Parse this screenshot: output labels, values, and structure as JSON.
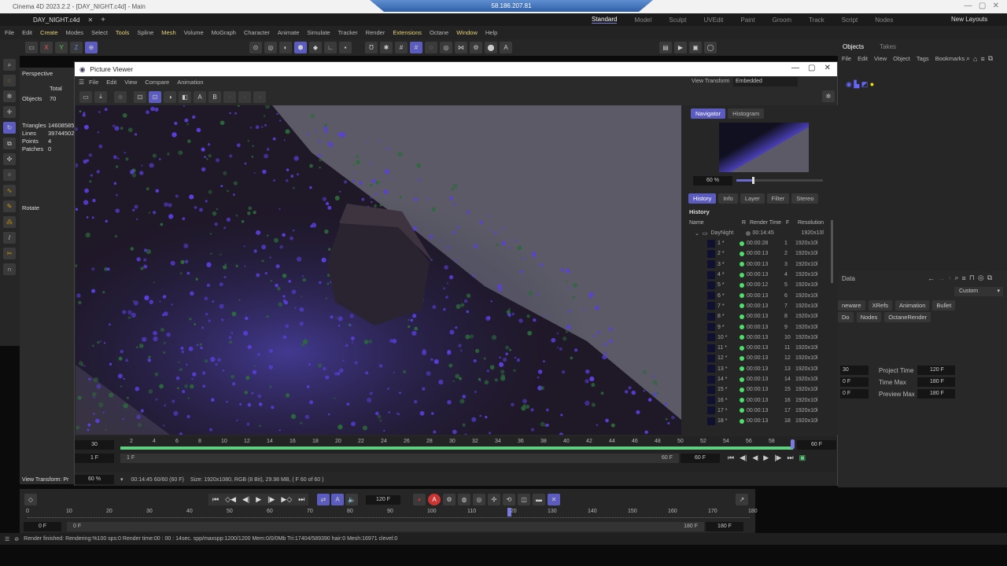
{
  "app": {
    "title": "Cinema 4D 2023.2.2 - [DAY_NIGHT.c4d] - Main",
    "remote_ip": "58.186.207.81",
    "doc_tab": "DAY_NIGHT.c4d",
    "layouts": [
      "Standard",
      "Model",
      "Sculpt",
      "UVEdit",
      "Paint",
      "Groom",
      "Track",
      "Script",
      "Nodes"
    ],
    "active_layout": "Standard",
    "new_layouts": "New Layouts"
  },
  "menu": [
    {
      "l": "File"
    },
    {
      "l": "Edit"
    },
    {
      "l": "Create",
      "y": true
    },
    {
      "l": "Modes"
    },
    {
      "l": "Select"
    },
    {
      "l": "Tools",
      "y": true
    },
    {
      "l": "Spline"
    },
    {
      "l": "Mesh",
      "y": true
    },
    {
      "l": "Volume"
    },
    {
      "l": "MoGraph"
    },
    {
      "l": "Character"
    },
    {
      "l": "Animate"
    },
    {
      "l": "Simulate"
    },
    {
      "l": "Tracker"
    },
    {
      "l": "Render"
    },
    {
      "l": "Extensions",
      "y": true
    },
    {
      "l": "Octane"
    },
    {
      "l": "Window",
      "y": true
    },
    {
      "l": "Help"
    }
  ],
  "toolbar": {
    "x": "X",
    "y": "Y",
    "z": "Z"
  },
  "viewport": {
    "name": "Perspective",
    "total": "Total",
    "objects_label": "Objects",
    "objects": "70",
    "triangles_label": "Triangles",
    "triangles": "14608585",
    "lines_label": "Lines",
    "lines": "39744502",
    "points_label": "Points",
    "points": "4",
    "patches_label": "Patches",
    "patches": "0",
    "rotate": "Rotate",
    "view_transform": "View Transform: Pr"
  },
  "picture_viewer": {
    "title": "Picture Viewer",
    "menu": [
      "File",
      "Edit",
      "View",
      "Compare",
      "Animation"
    ],
    "view_transform_label": "View Transform",
    "view_transform": "Embedded",
    "tool_a": "A",
    "tool_b": "B",
    "side_tabs": [
      "Navigator",
      "Histogram"
    ],
    "zoom": "60 %",
    "hist_tabs": [
      "History",
      "Info",
      "Layer",
      "Filter",
      "Stereo"
    ],
    "history_title": "History",
    "columns": [
      "Name",
      "R",
      "Render Time",
      "F",
      "Resolution"
    ],
    "folder": {
      "name": "DayNight",
      "time": "00:14:45",
      "res": "1920x10l"
    },
    "rows": [
      [
        "1 *",
        "00:00:28",
        "1"
      ],
      [
        "2 *",
        "00:00:13",
        "2"
      ],
      [
        "3 *",
        "00:00:13",
        "3"
      ],
      [
        "4 *",
        "00:00:13",
        "4"
      ],
      [
        "5 *",
        "00:00:12",
        "5"
      ],
      [
        "6 *",
        "00:00:13",
        "6"
      ],
      [
        "7 *",
        "00:00:13",
        "7"
      ],
      [
        "8 *",
        "00:00:13",
        "8"
      ],
      [
        "9 *",
        "00:00:13",
        "9"
      ],
      [
        "10 *",
        "00:00:13",
        "10"
      ],
      [
        "11 *",
        "00:00:13",
        "11"
      ],
      [
        "12 *",
        "00:00:13",
        "12"
      ],
      [
        "13 *",
        "00:00:13",
        "13"
      ],
      [
        "14 *",
        "00:00:13",
        "14"
      ],
      [
        "15 *",
        "00:00:13",
        "15"
      ],
      [
        "16 *",
        "00:00:13",
        "16"
      ],
      [
        "17 *",
        "00:00:13",
        "17"
      ],
      [
        "18 *",
        "00:00:13",
        "18"
      ]
    ],
    "row_res": "1920x10l",
    "timeline": {
      "fps": "30",
      "start": "1 F",
      "start_inner": "1 F",
      "ticks": [
        "2",
        "4",
        "6",
        "8",
        "10",
        "12",
        "14",
        "16",
        "18",
        "20",
        "22",
        "24",
        "26",
        "28",
        "30",
        "32",
        "34",
        "36",
        "38",
        "40",
        "42",
        "44",
        "46",
        "48",
        "50",
        "52",
        "54",
        "56",
        "58"
      ],
      "end": "60 F",
      "end_inner": "60 F",
      "current": "60 F",
      "progress": 1.0
    },
    "info_zoom": "60 %",
    "info_time": "00:14:45 60/60 (60 F)",
    "info_size": "Size: 1920x1080, RGB (8 Bit), 29.98 MB,  ( F 60 of 60 )"
  },
  "objects_panel": {
    "tabs": [
      "Objects",
      "Takes"
    ],
    "menu": [
      "File",
      "Edit",
      "View",
      "Object",
      "Tags",
      "Bookmarks"
    ]
  },
  "attributes": {
    "title": "Data",
    "mode": "Custom",
    "chips1": [
      "neware",
      "XRefs",
      "Animation",
      "Bullet"
    ],
    "chips2": [
      "Do",
      "Nodes",
      "OctaneRender"
    ],
    "fps": "30",
    "min": "0 F",
    "min2": "0 F",
    "project_time_label": "Project Time",
    "project_time": "120 F",
    "time_max_label": "Time Max",
    "time_max": "180 F",
    "preview_max_label": "Preview Max",
    "preview_max": "180 F"
  },
  "main_timeline": {
    "frame": "120 F",
    "ticks": [
      "0",
      "10",
      "20",
      "30",
      "40",
      "50",
      "60",
      "70",
      "80",
      "90",
      "100",
      "110",
      "120",
      "130",
      "140",
      "150",
      "160",
      "170",
      "180"
    ],
    "start": "0 F",
    "start_inner": "0 F",
    "end_inner": "180 F",
    "end": "180 F",
    "current": 120
  },
  "status": "Render finished: Rendering:%100 sps:0 Render time:00 : 00 : 14sec. spp/maxspp:1200/1200 Mem:0/0/0Mb Tri:17404/589390 hair:0 Mesh:16971 clevel:0",
  "colors": {
    "accent": "#5c5cc0",
    "progress": "#5fcf80",
    "highlight_menu": "#e6d27a"
  }
}
